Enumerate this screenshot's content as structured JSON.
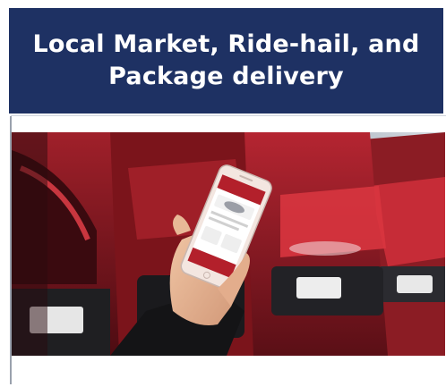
{
  "banner": {
    "title_line1": "Local Market, Ride-hail, and",
    "title_line2": "Package delivery",
    "background": "#1e3163",
    "text_color": "#ffffff"
  },
  "photo": {
    "subject": "Hand holding smartphone with ride app in front of a row of red cars"
  },
  "colors": {
    "car_red": "#8f1b22",
    "phone_frame": "#f3e6e0",
    "app_accent": "#b3202b"
  }
}
